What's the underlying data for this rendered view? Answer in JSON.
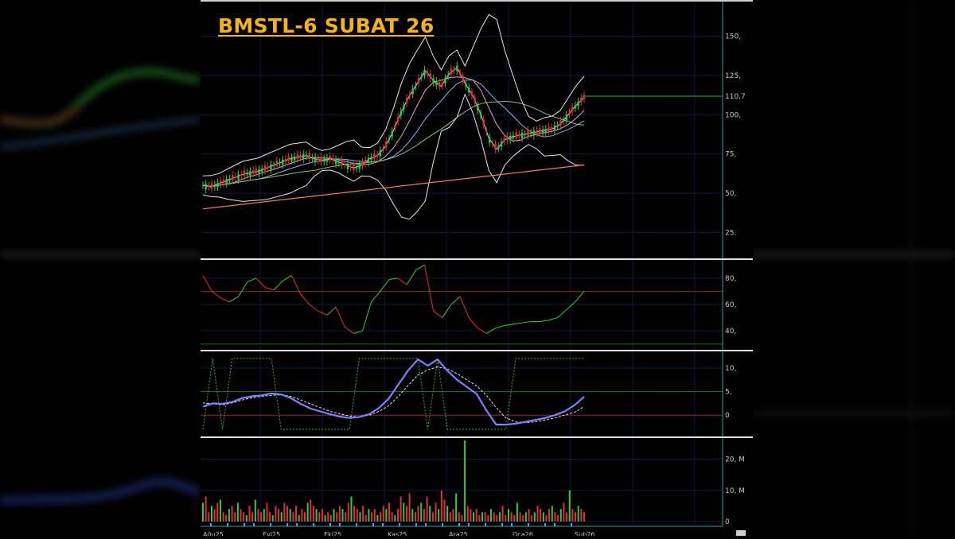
{
  "chart_data": {
    "title": "BMSTL-6 SUBAT 26",
    "colors": {
      "title": "#f5b31a",
      "up": "#2ecc40",
      "down": "#e53030",
      "bb": "#e6e6e6",
      "ma_long": "#f08060",
      "level": "#3cb043",
      "macd": "#8080ff",
      "signal": "#e6e6e6"
    },
    "price_panel": {
      "type": "line",
      "y_ticks": [
        "150,",
        "125,",
        "100,",
        "75,",
        "50,",
        "25,"
      ],
      "y_tick_values": [
        150,
        125,
        100,
        75,
        50,
        25
      ],
      "ylim": [
        10,
        170
      ],
      "last_value_label": "110,7",
      "last_value": 110.7,
      "series": [
        {
          "values": [
            55,
            54,
            56,
            58,
            60,
            62,
            63,
            64,
            66,
            68,
            70,
            72,
            73,
            74,
            72,
            71,
            72,
            70,
            68,
            66,
            68,
            72,
            74,
            80,
            90,
            102,
            112,
            120,
            128,
            122,
            118,
            126,
            130,
            120,
            112,
            100,
            85,
            78,
            84,
            86,
            87,
            88,
            89,
            90,
            91,
            94,
            100,
            106,
            111
          ]
        }
      ]
    },
    "rsi_panel": {
      "type": "line",
      "y_ticks": [
        "80,",
        "60,",
        "40,"
      ],
      "y_tick_values": [
        80,
        60,
        40
      ],
      "ylim": [
        28,
        92
      ],
      "series": [
        {
          "values": [
            82,
            70,
            65,
            62,
            66,
            77,
            80,
            73,
            71,
            78,
            82,
            68,
            60,
            55,
            52,
            58,
            43,
            38,
            40,
            62,
            70,
            79,
            80,
            75,
            86,
            90,
            55,
            50,
            60,
            66,
            50,
            42,
            38,
            42,
            44,
            45,
            46,
            47,
            47,
            48,
            50,
            56,
            62,
            70
          ]
        }
      ]
    },
    "macd_panel": {
      "type": "line",
      "y_ticks": [
        "10,",
        "5,",
        "0"
      ],
      "y_tick_values": [
        10,
        5,
        0
      ],
      "ylim": [
        -4,
        13
      ],
      "series": [
        {
          "values": [
            1.8,
            2.5,
            2.4,
            2.8,
            3.6,
            4.0,
            4.2,
            4.6,
            4.4,
            3.6,
            2.4,
            1.4,
            0.8,
            0.2,
            -0.3,
            -0.6,
            -0.4,
            0.2,
            1.5,
            3.5,
            6.5,
            9.5,
            11.8,
            10.5,
            11.8,
            9.4,
            7.5,
            6.0,
            4.5,
            1.0,
            -2.0,
            -2.0,
            -1.8,
            -1.4,
            -1.0,
            -0.6,
            0.0,
            0.8,
            2.1,
            3.9
          ]
        },
        {
          "values": [
            2.6,
            2.4,
            2.2,
            2.6,
            3.2,
            3.7,
            4.0,
            4.2,
            4.3,
            4.0,
            3.2,
            2.4,
            1.6,
            0.8,
            0.3,
            -0.2,
            -0.4,
            0.0,
            0.8,
            2.0,
            4.0,
            6.3,
            8.5,
            9.6,
            10.2,
            9.8,
            8.8,
            7.5,
            6.2,
            4.2,
            1.6,
            -0.6,
            -1.4,
            -1.6,
            -1.4,
            -1.0,
            -0.6,
            0.0,
            0.6,
            1.8
          ]
        }
      ]
    },
    "volume_panel": {
      "type": "bar",
      "y_ticks": [
        "20, M",
        "10, M",
        "0"
      ],
      "y_tick_values": [
        20,
        10,
        0
      ],
      "ylim": [
        0,
        26
      ],
      "values": [
        6,
        8,
        3,
        5,
        4,
        6,
        7,
        3,
        2,
        4,
        5,
        3,
        6,
        4,
        3,
        2,
        5,
        3,
        7,
        4,
        3,
        4,
        6,
        3,
        2,
        5,
        4,
        3,
        6,
        5,
        4,
        3,
        5,
        2,
        4,
        3,
        6,
        7,
        5,
        4,
        3,
        4,
        2,
        3,
        2,
        4,
        3,
        5,
        4,
        3,
        6,
        8,
        5,
        4,
        3,
        5,
        2,
        4,
        3,
        4,
        2,
        3,
        5,
        4,
        6,
        3,
        2,
        4,
        8,
        6,
        5,
        9,
        4,
        3,
        5,
        6,
        4,
        8,
        5,
        3,
        6,
        4,
        10,
        7,
        5,
        3,
        4,
        9,
        3,
        2,
        26,
        5,
        4,
        3,
        4,
        2,
        3,
        3,
        2,
        4,
        3,
        2,
        3,
        5,
        2,
        4,
        3,
        2,
        6,
        3,
        2,
        3,
        4,
        2,
        3,
        5,
        4,
        3,
        2,
        4,
        5,
        3,
        2,
        4,
        6,
        3,
        10,
        4,
        3,
        5,
        4,
        3
      ]
    },
    "x_ticks": [
      "Ağu25",
      "Eyl25",
      "Eki25",
      "Kas25",
      "Ara25",
      "Oca26",
      "Şub26"
    ]
  }
}
